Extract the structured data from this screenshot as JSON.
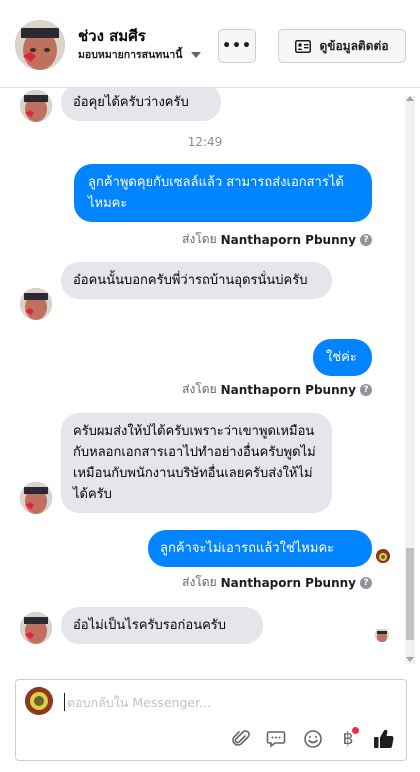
{
  "header": {
    "name": "ช่วง สมศีร",
    "subtitle": "มอบหมายการสนทนานี้",
    "more_label": "•••",
    "contact_label": "ดูข้อมูลติดต่อ"
  },
  "messages": [
    {
      "side": "in",
      "text": "อ๋อคุยได้ครับว่างครับ"
    },
    {
      "type": "time",
      "text": "12:49"
    },
    {
      "side": "out",
      "text": "ลูกค้าพูดคุยกับเซลล์แล้ว สามารถส่งเอกสารได้ไหมคะ",
      "sent_prefix": "ส่งโดย",
      "sent_by": "Nanthaporn Pbunny"
    },
    {
      "side": "in",
      "text": "อ๋อคนนั้นบอกครับพี่ว่ารถบ้านอุดรนั่นบ่ครับ"
    },
    {
      "side": "out",
      "text": "ใช่ค่ะ",
      "sent_prefix": "ส่งโดย",
      "sent_by": "Nanthaporn Pbunny"
    },
    {
      "side": "in",
      "text": "ครับผมส่งให้ป่ได้ครับเพราะว่าเขาพูดเหมือนกับหลอกเอกสารเอาไปทำอย่างอื่นครับพูดไม่เหมือนกับพนักงานบริษัทอื่นเลยครับส่งให้ไม่ได้ครับ"
    },
    {
      "side": "out",
      "text": "ลูกค้าจะไม่เอารถแล้วใช่ไหมคะ",
      "sent_prefix": "ส่งโดย",
      "sent_by": "Nanthaporn Pbunny"
    },
    {
      "side": "in",
      "text": "อ๋อไม่เป็นไรครับรอก่อนครับ"
    }
  ],
  "composer": {
    "placeholder": "ตอบกลับใน Messenger..."
  },
  "icons": [
    "caret-down-icon",
    "contact-card-icon",
    "attach-icon",
    "saved-reply-icon",
    "emoji-icon",
    "baht-icon",
    "like-icon",
    "help-icon"
  ],
  "colors": {
    "outgoing_bubble": "#0084ff",
    "incoming_bubble": "#e4e6eb",
    "like": "#1c1e21",
    "notification_dot": "#f02849"
  }
}
